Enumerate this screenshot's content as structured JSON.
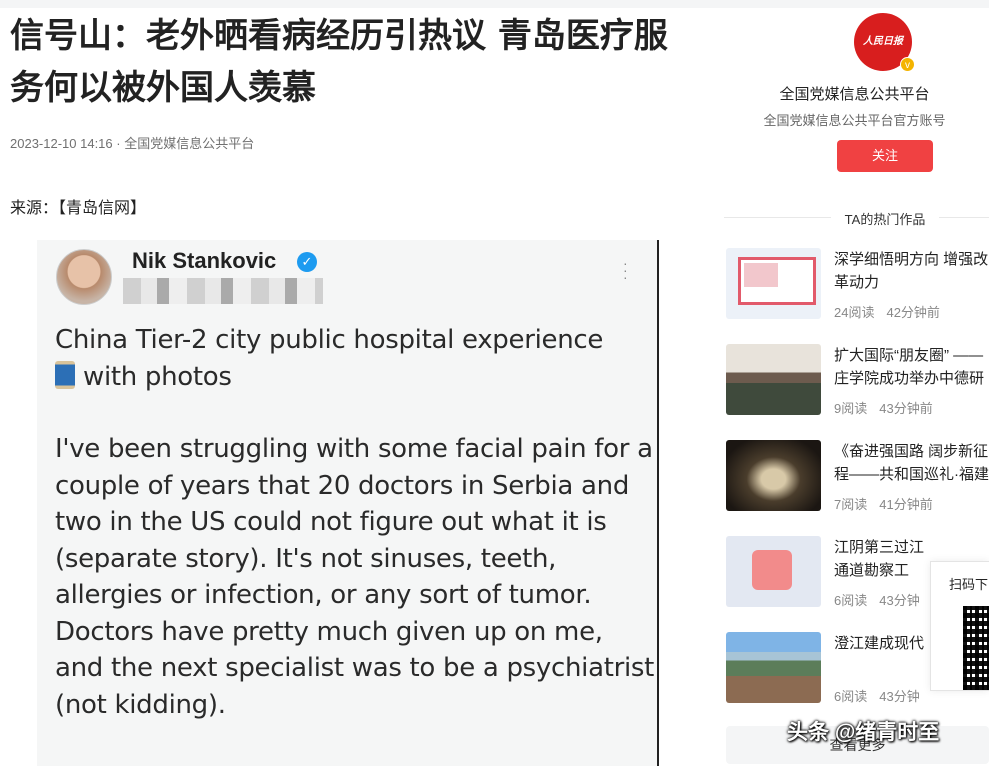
{
  "article": {
    "title": "信号山：老外晒看病经历引热议 青岛医疗服务何以被外国人羡慕",
    "meta": "2023-12-10 14:16 · 全国党媒信息公共平台",
    "source": "来源：【青岛信网】"
  },
  "tweet": {
    "author": "Nik Stankovic",
    "intro": "China Tier-2 city public hospital experience",
    "intro_tail": "with photos",
    "body": "I've been struggling with some facial pain for a couple of years that 20 doctors in Serbia and two in the US could not figure out what it is (separate story). It's not sinuses, teeth, allergies or infection, or any sort of tumor. Doctors have pretty much given up on me, and the next specialist was to be a psychiatrist (not kidding).",
    "icons": {
      "verified": "verified-icon",
      "more": "more-options-icon",
      "thread": "thread-icon"
    }
  },
  "sidebar": {
    "account_name": "全国党媒信息公共平台",
    "account_desc": "全国党媒信息公共平台官方账号",
    "follow_label": "关注",
    "hot_title": "TA的热门作品",
    "items": [
      {
        "title": "深学细悟明方向 增强改革动力",
        "reads": "24阅读",
        "time": "42分钟前"
      },
      {
        "title": "扩大国际“朋友圈” —— 庄学院成功举办中德研",
        "reads": "9阅读",
        "time": "43分钟前"
      },
      {
        "title": "《奋进强国路 阔步新征程——共和国巡礼·福建篇",
        "reads": "7阅读",
        "time": "41分钟前"
      },
      {
        "title": "江阴第三过江通道勘察工",
        "reads": "6阅读",
        "time": "43分钟"
      },
      {
        "title": "澄江建成现代",
        "reads": "6阅读",
        "time": "43分钟"
      }
    ],
    "more_label": "查看更多",
    "qr_label": "扫码下"
  },
  "watermark": "头条 @绪青时至",
  "colors": {
    "accent": "#f04142",
    "verified": "#1d9bf0"
  }
}
